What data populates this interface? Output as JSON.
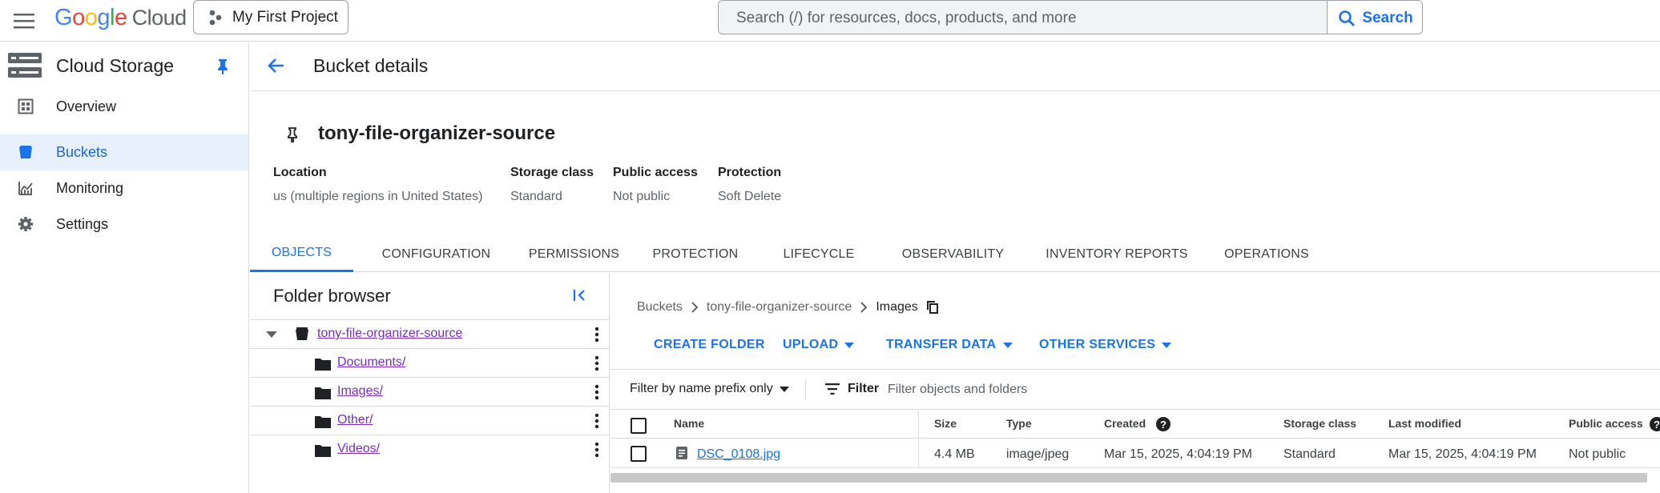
{
  "topbar": {
    "logo": {
      "g": "G",
      "o1": "o",
      "o2": "o",
      "g2": "g",
      "l": "l",
      "e": "e",
      "cloud": "Cloud"
    },
    "project": "My First Project",
    "search_placeholder": "Search (/) for resources, docs, products, and more",
    "search_button": "Search"
  },
  "sidebar": {
    "title": "Cloud Storage",
    "items": [
      {
        "label": "Overview",
        "icon": "dashboard-icon"
      },
      {
        "label": "Buckets",
        "icon": "bucket-icon",
        "active": true
      },
      {
        "label": "Monitoring",
        "icon": "chart-icon"
      },
      {
        "label": "Settings",
        "icon": "gear-icon"
      }
    ]
  },
  "header": {
    "title": "Bucket details"
  },
  "bucket": {
    "name": "tony-file-organizer-source",
    "info": [
      {
        "label": "Location",
        "value": "us (multiple regions in United States)"
      },
      {
        "label": "Storage class",
        "value": "Standard"
      },
      {
        "label": "Public access",
        "value": "Not public"
      },
      {
        "label": "Protection",
        "value": "Soft Delete"
      }
    ]
  },
  "tabs": [
    "OBJECTS",
    "CONFIGURATION",
    "PERMISSIONS",
    "PROTECTION",
    "LIFECYCLE",
    "OBSERVABILITY",
    "INVENTORY REPORTS",
    "OPERATIONS"
  ],
  "folder_browser": {
    "title": "Folder browser",
    "bucket": "tony-file-organizer-source",
    "folders": [
      "Documents/",
      "Images/",
      "Other/",
      "Videos/"
    ]
  },
  "objects": {
    "breadcrumb": [
      "Buckets",
      "tony-file-organizer-source",
      "Images"
    ],
    "actions": [
      "CREATE FOLDER",
      "UPLOAD",
      "TRANSFER DATA",
      "OTHER SERVICES"
    ],
    "filter_mode": "Filter by name prefix only",
    "filter_label": "Filter",
    "filter_placeholder": "Filter objects and folders",
    "columns": [
      "Name",
      "Size",
      "Type",
      "Created",
      "Storage class",
      "Last modified",
      "Public access"
    ],
    "rows": [
      {
        "name": "DSC_0108.jpg",
        "size": "4.4 MB",
        "type": "image/jpeg",
        "created": "Mar 15, 2025, 4:04:19 PM",
        "storage_class": "Standard",
        "last_modified": "Mar 15, 2025, 4:04:19 PM",
        "public_access": "Not public"
      }
    ]
  },
  "colors": {
    "accent": "#1a73e8",
    "active_bg": "#e8f0fe",
    "link_visited": "#7b2bbf"
  }
}
